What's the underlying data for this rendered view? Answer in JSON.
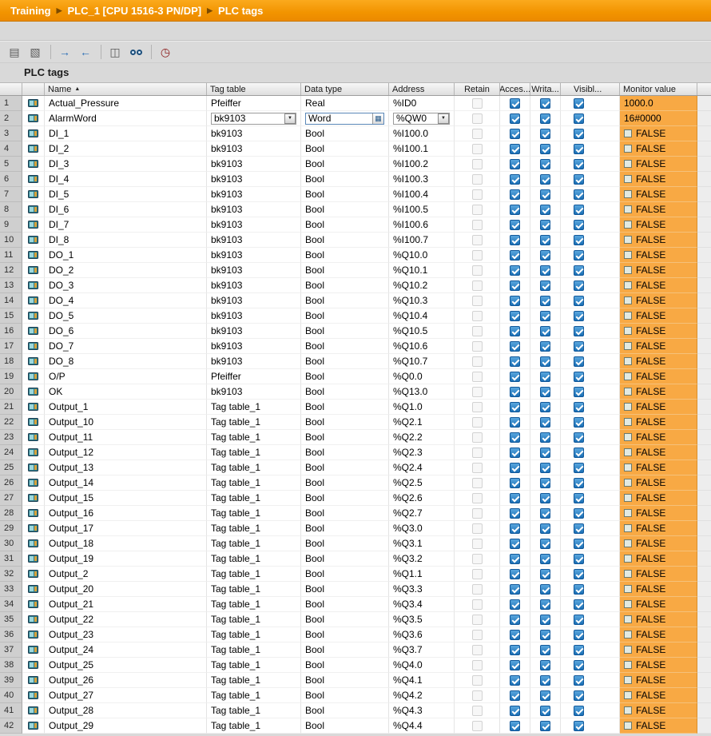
{
  "breadcrumb": {
    "items": [
      "Training",
      "PLC_1 [CPU 1516-3 PN/DP]",
      "PLC tags"
    ]
  },
  "toolbar": {
    "groups": [
      [
        {
          "name": "insert-row-icon",
          "glyph": "▤",
          "color": "#5a5a5a"
        },
        {
          "name": "add-row-icon",
          "glyph": "▧",
          "color": "#5a5a5a"
        }
      ],
      [
        {
          "name": "export-icon",
          "glyph": "→",
          "color": "#2a6db5"
        },
        {
          "name": "import-icon",
          "glyph": "←",
          "color": "#2a6db5"
        }
      ],
      [
        {
          "name": "snapshot-icon",
          "glyph": "◫",
          "color": "#5a5a5a"
        },
        {
          "name": "monitor-all-icon",
          "glyph": ""
        }
      ],
      [
        {
          "name": "retain-icon",
          "glyph": "◷",
          "color": "#8b1a1a"
        }
      ]
    ]
  },
  "section_title": "PLC tags",
  "colors": {
    "brand_orange": "#f29400",
    "monitor_value_orange": "#f8a944",
    "checkbox_blue": "#1a6fb5"
  },
  "table": {
    "columns": [
      "",
      "",
      "Name",
      "Tag table",
      "Data type",
      "Address",
      "Retain",
      "Acces...",
      "Writa...",
      "Visibl...",
      "Monitor value"
    ],
    "sort_indicator": {
      "column": "Name",
      "direction": "asc",
      "glyph": "▲"
    },
    "rows": [
      {
        "num": 1,
        "name": "Actual_Pressure",
        "tag_table": "Pfeiffer",
        "data_type": "Real",
        "address": "%ID0",
        "retain": false,
        "accessible": true,
        "writable": true,
        "visible": true,
        "monitor": "1000.0",
        "monitor_is_bool": false,
        "editing": false
      },
      {
        "num": 2,
        "name": "AlarmWord",
        "tag_table": "bk9103",
        "data_type": "Word",
        "address": "%QW0",
        "retain": false,
        "accessible": true,
        "writable": true,
        "visible": true,
        "monitor": "16#0000",
        "monitor_is_bool": false,
        "editing": true
      },
      {
        "num": 3,
        "name": "DI_1",
        "tag_table": "bk9103",
        "data_type": "Bool",
        "address": "%I100.0",
        "retain": false,
        "accessible": true,
        "writable": true,
        "visible": true,
        "monitor": "FALSE",
        "monitor_is_bool": true,
        "editing": false
      },
      {
        "num": 4,
        "name": "DI_2",
        "tag_table": "bk9103",
        "data_type": "Bool",
        "address": "%I100.1",
        "retain": false,
        "accessible": true,
        "writable": true,
        "visible": true,
        "monitor": "FALSE",
        "monitor_is_bool": true,
        "editing": false
      },
      {
        "num": 5,
        "name": "DI_3",
        "tag_table": "bk9103",
        "data_type": "Bool",
        "address": "%I100.2",
        "retain": false,
        "accessible": true,
        "writable": true,
        "visible": true,
        "monitor": "FALSE",
        "monitor_is_bool": true,
        "editing": false
      },
      {
        "num": 6,
        "name": "DI_4",
        "tag_table": "bk9103",
        "data_type": "Bool",
        "address": "%I100.3",
        "retain": false,
        "accessible": true,
        "writable": true,
        "visible": true,
        "monitor": "FALSE",
        "monitor_is_bool": true,
        "editing": false
      },
      {
        "num": 7,
        "name": "DI_5",
        "tag_table": "bk9103",
        "data_type": "Bool",
        "address": "%I100.4",
        "retain": false,
        "accessible": true,
        "writable": true,
        "visible": true,
        "monitor": "FALSE",
        "monitor_is_bool": true,
        "editing": false
      },
      {
        "num": 8,
        "name": "DI_6",
        "tag_table": "bk9103",
        "data_type": "Bool",
        "address": "%I100.5",
        "retain": false,
        "accessible": true,
        "writable": true,
        "visible": true,
        "monitor": "FALSE",
        "monitor_is_bool": true,
        "editing": false
      },
      {
        "num": 9,
        "name": "DI_7",
        "tag_table": "bk9103",
        "data_type": "Bool",
        "address": "%I100.6",
        "retain": false,
        "accessible": true,
        "writable": true,
        "visible": true,
        "monitor": "FALSE",
        "monitor_is_bool": true,
        "editing": false
      },
      {
        "num": 10,
        "name": "DI_8",
        "tag_table": "bk9103",
        "data_type": "Bool",
        "address": "%I100.7",
        "retain": false,
        "accessible": true,
        "writable": true,
        "visible": true,
        "monitor": "FALSE",
        "monitor_is_bool": true,
        "editing": false
      },
      {
        "num": 11,
        "name": "DO_1",
        "tag_table": "bk9103",
        "data_type": "Bool",
        "address": "%Q10.0",
        "retain": false,
        "accessible": true,
        "writable": true,
        "visible": true,
        "monitor": "FALSE",
        "monitor_is_bool": true,
        "editing": false
      },
      {
        "num": 12,
        "name": "DO_2",
        "tag_table": "bk9103",
        "data_type": "Bool",
        "address": "%Q10.1",
        "retain": false,
        "accessible": true,
        "writable": true,
        "visible": true,
        "monitor": "FALSE",
        "monitor_is_bool": true,
        "editing": false
      },
      {
        "num": 13,
        "name": "DO_3",
        "tag_table": "bk9103",
        "data_type": "Bool",
        "address": "%Q10.2",
        "retain": false,
        "accessible": true,
        "writable": true,
        "visible": true,
        "monitor": "FALSE",
        "monitor_is_bool": true,
        "editing": false
      },
      {
        "num": 14,
        "name": "DO_4",
        "tag_table": "bk9103",
        "data_type": "Bool",
        "address": "%Q10.3",
        "retain": false,
        "accessible": true,
        "writable": true,
        "visible": true,
        "monitor": "FALSE",
        "monitor_is_bool": true,
        "editing": false
      },
      {
        "num": 15,
        "name": "DO_5",
        "tag_table": "bk9103",
        "data_type": "Bool",
        "address": "%Q10.4",
        "retain": false,
        "accessible": true,
        "writable": true,
        "visible": true,
        "monitor": "FALSE",
        "monitor_is_bool": true,
        "editing": false
      },
      {
        "num": 16,
        "name": "DO_6",
        "tag_table": "bk9103",
        "data_type": "Bool",
        "address": "%Q10.5",
        "retain": false,
        "accessible": true,
        "writable": true,
        "visible": true,
        "monitor": "FALSE",
        "monitor_is_bool": true,
        "editing": false
      },
      {
        "num": 17,
        "name": "DO_7",
        "tag_table": "bk9103",
        "data_type": "Bool",
        "address": "%Q10.6",
        "retain": false,
        "accessible": true,
        "writable": true,
        "visible": true,
        "monitor": "FALSE",
        "monitor_is_bool": true,
        "editing": false
      },
      {
        "num": 18,
        "name": "DO_8",
        "tag_table": "bk9103",
        "data_type": "Bool",
        "address": "%Q10.7",
        "retain": false,
        "accessible": true,
        "writable": true,
        "visible": true,
        "monitor": "FALSE",
        "monitor_is_bool": true,
        "editing": false
      },
      {
        "num": 19,
        "name": "O/P",
        "tag_table": "Pfeiffer",
        "data_type": "Bool",
        "address": "%Q0.0",
        "retain": false,
        "accessible": true,
        "writable": true,
        "visible": true,
        "monitor": "FALSE",
        "monitor_is_bool": true,
        "editing": false
      },
      {
        "num": 20,
        "name": "OK",
        "tag_table": "bk9103",
        "data_type": "Bool",
        "address": "%Q13.0",
        "retain": false,
        "accessible": true,
        "writable": true,
        "visible": true,
        "monitor": "FALSE",
        "monitor_is_bool": true,
        "editing": false
      },
      {
        "num": 21,
        "name": "Output_1",
        "tag_table": "Tag table_1",
        "data_type": "Bool",
        "address": "%Q1.0",
        "retain": false,
        "accessible": true,
        "writable": true,
        "visible": true,
        "monitor": "FALSE",
        "monitor_is_bool": true,
        "editing": false
      },
      {
        "num": 22,
        "name": "Output_10",
        "tag_table": "Tag table_1",
        "data_type": "Bool",
        "address": "%Q2.1",
        "retain": false,
        "accessible": true,
        "writable": true,
        "visible": true,
        "monitor": "FALSE",
        "monitor_is_bool": true,
        "editing": false
      },
      {
        "num": 23,
        "name": "Output_11",
        "tag_table": "Tag table_1",
        "data_type": "Bool",
        "address": "%Q2.2",
        "retain": false,
        "accessible": true,
        "writable": true,
        "visible": true,
        "monitor": "FALSE",
        "monitor_is_bool": true,
        "editing": false
      },
      {
        "num": 24,
        "name": "Output_12",
        "tag_table": "Tag table_1",
        "data_type": "Bool",
        "address": "%Q2.3",
        "retain": false,
        "accessible": true,
        "writable": true,
        "visible": true,
        "monitor": "FALSE",
        "monitor_is_bool": true,
        "editing": false
      },
      {
        "num": 25,
        "name": "Output_13",
        "tag_table": "Tag table_1",
        "data_type": "Bool",
        "address": "%Q2.4",
        "retain": false,
        "accessible": true,
        "writable": true,
        "visible": true,
        "monitor": "FALSE",
        "monitor_is_bool": true,
        "editing": false
      },
      {
        "num": 26,
        "name": "Output_14",
        "tag_table": "Tag table_1",
        "data_type": "Bool",
        "address": "%Q2.5",
        "retain": false,
        "accessible": true,
        "writable": true,
        "visible": true,
        "monitor": "FALSE",
        "monitor_is_bool": true,
        "editing": false
      },
      {
        "num": 27,
        "name": "Output_15",
        "tag_table": "Tag table_1",
        "data_type": "Bool",
        "address": "%Q2.6",
        "retain": false,
        "accessible": true,
        "writable": true,
        "visible": true,
        "monitor": "FALSE",
        "monitor_is_bool": true,
        "editing": false
      },
      {
        "num": 28,
        "name": "Output_16",
        "tag_table": "Tag table_1",
        "data_type": "Bool",
        "address": "%Q2.7",
        "retain": false,
        "accessible": true,
        "writable": true,
        "visible": true,
        "monitor": "FALSE",
        "monitor_is_bool": true,
        "editing": false
      },
      {
        "num": 29,
        "name": "Output_17",
        "tag_table": "Tag table_1",
        "data_type": "Bool",
        "address": "%Q3.0",
        "retain": false,
        "accessible": true,
        "writable": true,
        "visible": true,
        "monitor": "FALSE",
        "monitor_is_bool": true,
        "editing": false
      },
      {
        "num": 30,
        "name": "Output_18",
        "tag_table": "Tag table_1",
        "data_type": "Bool",
        "address": "%Q3.1",
        "retain": false,
        "accessible": true,
        "writable": true,
        "visible": true,
        "monitor": "FALSE",
        "monitor_is_bool": true,
        "editing": false
      },
      {
        "num": 31,
        "name": "Output_19",
        "tag_table": "Tag table_1",
        "data_type": "Bool",
        "address": "%Q3.2",
        "retain": false,
        "accessible": true,
        "writable": true,
        "visible": true,
        "monitor": "FALSE",
        "monitor_is_bool": true,
        "editing": false
      },
      {
        "num": 32,
        "name": "Output_2",
        "tag_table": "Tag table_1",
        "data_type": "Bool",
        "address": "%Q1.1",
        "retain": false,
        "accessible": true,
        "writable": true,
        "visible": true,
        "monitor": "FALSE",
        "monitor_is_bool": true,
        "editing": false
      },
      {
        "num": 33,
        "name": "Output_20",
        "tag_table": "Tag table_1",
        "data_type": "Bool",
        "address": "%Q3.3",
        "retain": false,
        "accessible": true,
        "writable": true,
        "visible": true,
        "monitor": "FALSE",
        "monitor_is_bool": true,
        "editing": false
      },
      {
        "num": 34,
        "name": "Output_21",
        "tag_table": "Tag table_1",
        "data_type": "Bool",
        "address": "%Q3.4",
        "retain": false,
        "accessible": true,
        "writable": true,
        "visible": true,
        "monitor": "FALSE",
        "monitor_is_bool": true,
        "editing": false
      },
      {
        "num": 35,
        "name": "Output_22",
        "tag_table": "Tag table_1",
        "data_type": "Bool",
        "address": "%Q3.5",
        "retain": false,
        "accessible": true,
        "writable": true,
        "visible": true,
        "monitor": "FALSE",
        "monitor_is_bool": true,
        "editing": false
      },
      {
        "num": 36,
        "name": "Output_23",
        "tag_table": "Tag table_1",
        "data_type": "Bool",
        "address": "%Q3.6",
        "retain": false,
        "accessible": true,
        "writable": true,
        "visible": true,
        "monitor": "FALSE",
        "monitor_is_bool": true,
        "editing": false
      },
      {
        "num": 37,
        "name": "Output_24",
        "tag_table": "Tag table_1",
        "data_type": "Bool",
        "address": "%Q3.7",
        "retain": false,
        "accessible": true,
        "writable": true,
        "visible": true,
        "monitor": "FALSE",
        "monitor_is_bool": true,
        "editing": false
      },
      {
        "num": 38,
        "name": "Output_25",
        "tag_table": "Tag table_1",
        "data_type": "Bool",
        "address": "%Q4.0",
        "retain": false,
        "accessible": true,
        "writable": true,
        "visible": true,
        "monitor": "FALSE",
        "monitor_is_bool": true,
        "editing": false
      },
      {
        "num": 39,
        "name": "Output_26",
        "tag_table": "Tag table_1",
        "data_type": "Bool",
        "address": "%Q4.1",
        "retain": false,
        "accessible": true,
        "writable": true,
        "visible": true,
        "monitor": "FALSE",
        "monitor_is_bool": true,
        "editing": false
      },
      {
        "num": 40,
        "name": "Output_27",
        "tag_table": "Tag table_1",
        "data_type": "Bool",
        "address": "%Q4.2",
        "retain": false,
        "accessible": true,
        "writable": true,
        "visible": true,
        "monitor": "FALSE",
        "monitor_is_bool": true,
        "editing": false
      },
      {
        "num": 41,
        "name": "Output_28",
        "tag_table": "Tag table_1",
        "data_type": "Bool",
        "address": "%Q4.3",
        "retain": false,
        "accessible": true,
        "writable": true,
        "visible": true,
        "monitor": "FALSE",
        "monitor_is_bool": true,
        "editing": false
      },
      {
        "num": 42,
        "name": "Output_29",
        "tag_table": "Tag table_1",
        "data_type": "Bool",
        "address": "%Q4.4",
        "retain": false,
        "accessible": true,
        "writable": true,
        "visible": true,
        "monitor": "FALSE",
        "monitor_is_bool": true,
        "editing": false
      }
    ]
  }
}
